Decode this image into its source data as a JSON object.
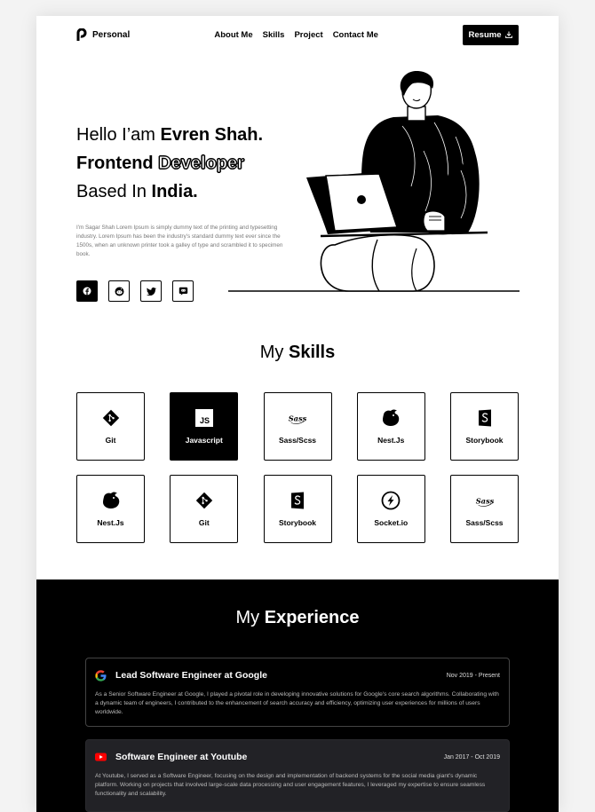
{
  "nav": {
    "brand": "Personal",
    "links": [
      "About Me",
      "Skills",
      "Project",
      "Contact Me"
    ],
    "resume_label": "Resume"
  },
  "hero": {
    "line1_prefix": "Hello I’am",
    "line1_name": "Evren Shah.",
    "line2_bold": "Frontend",
    "line2_outline": "Developer",
    "line3_prefix": "Based In",
    "line3_place": "India.",
    "description": "I'm Sagar Shah Lorem Ipsum is simply dummy text of the printing and typesetting industry. Lorem Ipsum has been the industry's standard dummy text ever since the 1500s, when an unknown printer took a galley of type and scrambled it to specimen book.",
    "socials": [
      "facebook-icon",
      "reddit-icon",
      "twitter-icon",
      "discord-icon"
    ]
  },
  "skills": {
    "title_prefix": "My",
    "title_bold": "Skills",
    "items": [
      {
        "label": "Git",
        "icon": "git-icon"
      },
      {
        "label": "Javascript",
        "icon": "javascript-icon"
      },
      {
        "label": "Sass/Scss",
        "icon": "sass-icon"
      },
      {
        "label": "Nest.Js",
        "icon": "nestjs-icon"
      },
      {
        "label": "Storybook",
        "icon": "storybook-icon"
      },
      {
        "label": "Nest.Js",
        "icon": "nestjs-icon"
      },
      {
        "label": "Git",
        "icon": "git-icon"
      },
      {
        "label": "Storybook",
        "icon": "storybook-icon"
      },
      {
        "label": "Socket.io",
        "icon": "socketio-icon"
      },
      {
        "label": "Sass/Scss",
        "icon": "sass-icon"
      }
    ],
    "js_badge": "JS",
    "sass_mark": "Sass"
  },
  "experience": {
    "title_prefix": "My",
    "title_bold": "Experience",
    "items": [
      {
        "role": "Lead Software Engineer at Google",
        "date": "Nov 2019 - Present",
        "icon": "google-icon",
        "text": "As a Senior Software Engineer at Google, I played a pivotal role in developing innovative solutions for Google's core search algorithms. Collaborating with a dynamic team of engineers, I contributed to the enhancement of search accuracy and efficiency, optimizing user experiences for millions of users worldwide."
      },
      {
        "role": "Software Engineer at Youtube",
        "date": "Jan 2017 - Oct 2019",
        "icon": "youtube-icon",
        "text": "At Youtube, I served as a  Software Engineer, focusing on the design and implementation of backend systems for the social media giant's dynamic platform. Working on projects that involved large-scale data processing and user engagement features, I leveraged my expertise to ensure seamless functionality and scalability."
      }
    ]
  },
  "colors": {
    "accent": "#000000",
    "background": "#ffffff",
    "youtube_red": "#ff0000"
  }
}
